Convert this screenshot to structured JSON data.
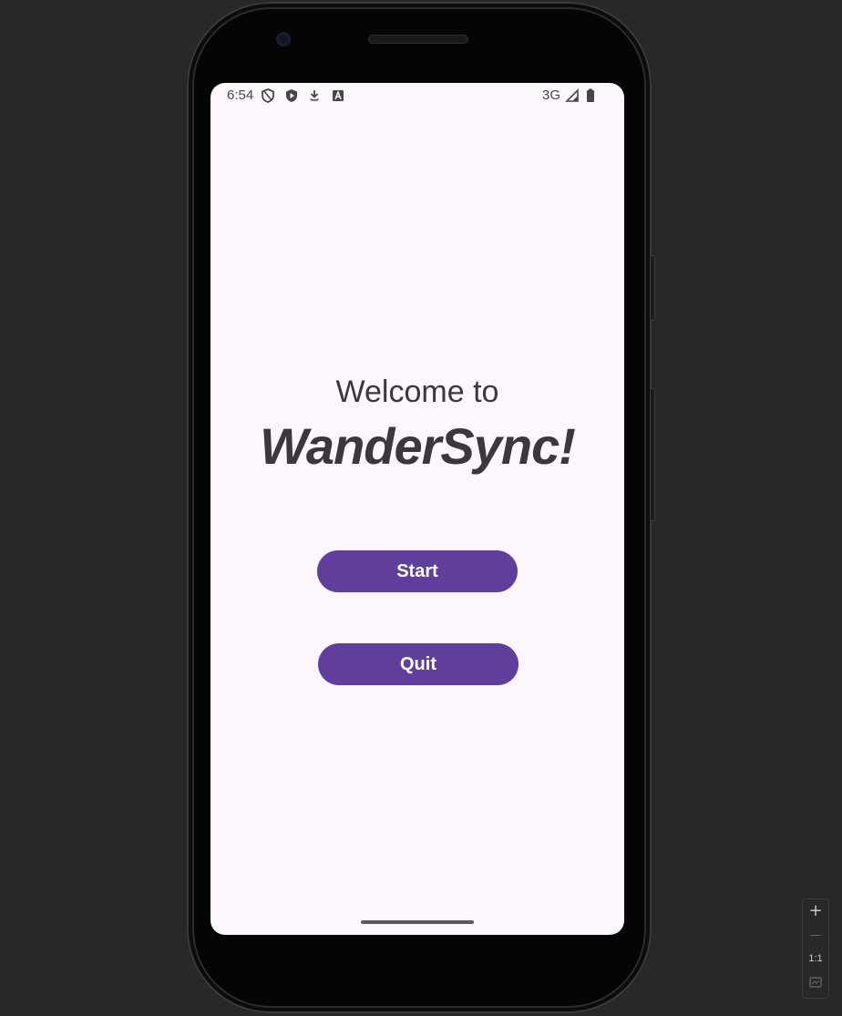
{
  "status_bar": {
    "time": "6:54",
    "network": "3G",
    "icons": [
      "shield-outline-icon",
      "shield-play-icon",
      "download-icon",
      "font-a-icon",
      "signal-icon",
      "battery-icon"
    ]
  },
  "main": {
    "welcome_text": "Welcome to",
    "app_name": "WanderSync!"
  },
  "buttons": {
    "start_label": "Start",
    "quit_label": "Quit",
    "color": "#5f3f9b"
  },
  "zoom_controls": {
    "zoom_in_symbol": "+",
    "zoom_out_symbol": "—",
    "actual_size_label": "1:1"
  },
  "colors": {
    "screen_background": "#fdf6fc",
    "text": "#3a373f",
    "desktop_background": "#27282a"
  }
}
